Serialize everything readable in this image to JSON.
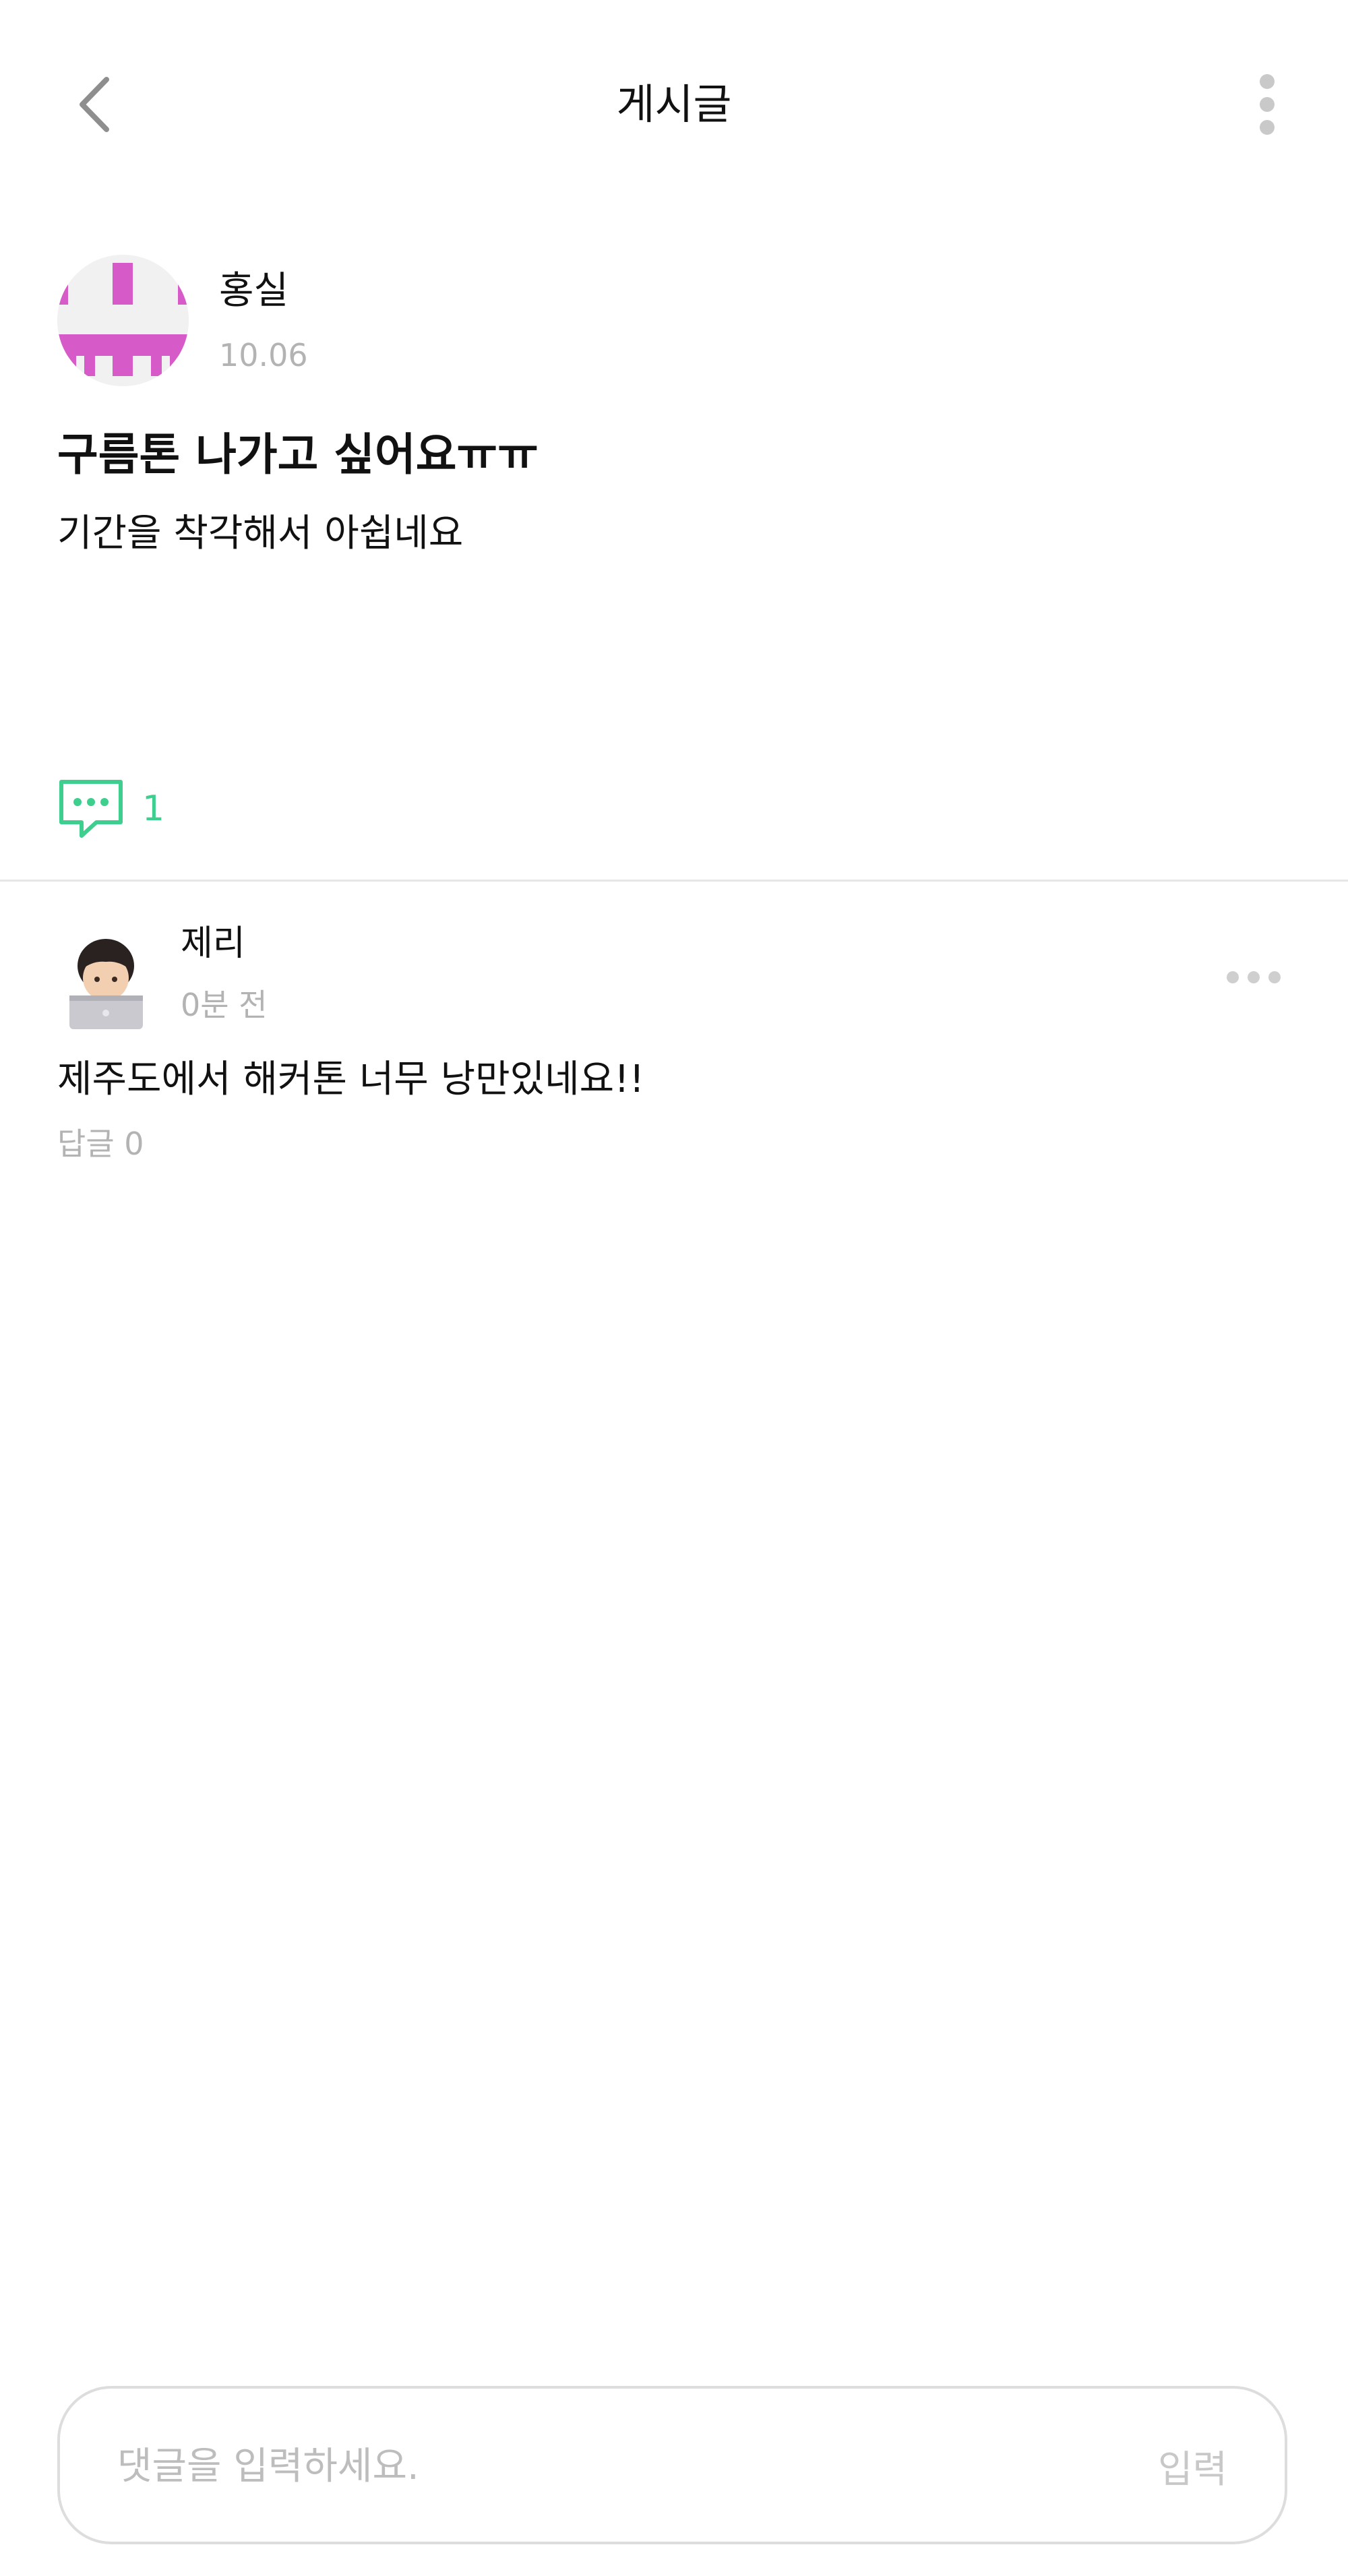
{
  "header": {
    "title": "게시글",
    "back_icon": "chevron-left-icon",
    "more_icon": "vertical-dots-icon"
  },
  "post": {
    "author": "홍실",
    "date": "10.06",
    "title": "구름톤 나가고 싶어요ㅠㅠ",
    "body": "기간을 착각해서 아쉽네요",
    "comment_icon": "comment-bubble-icon",
    "comment_count": "1",
    "avatar_icon": "plus-pattern-avatar",
    "avatar_color": "#d65bc8"
  },
  "comment": {
    "author": "제리",
    "time": "0분 전",
    "text": "제주도에서 해커톤 너무 낭만있네요!!",
    "reply_count": "답글 0",
    "avatar_icon": "memoji-laptop-avatar",
    "more_icon": "horizontal-dots-icon"
  },
  "input": {
    "placeholder": "댓글을 입력하세요.",
    "value": "",
    "submit_label": "입력"
  },
  "colors": {
    "accent_green": "#3ecf8e",
    "muted_gray": "#b3b3b3"
  }
}
